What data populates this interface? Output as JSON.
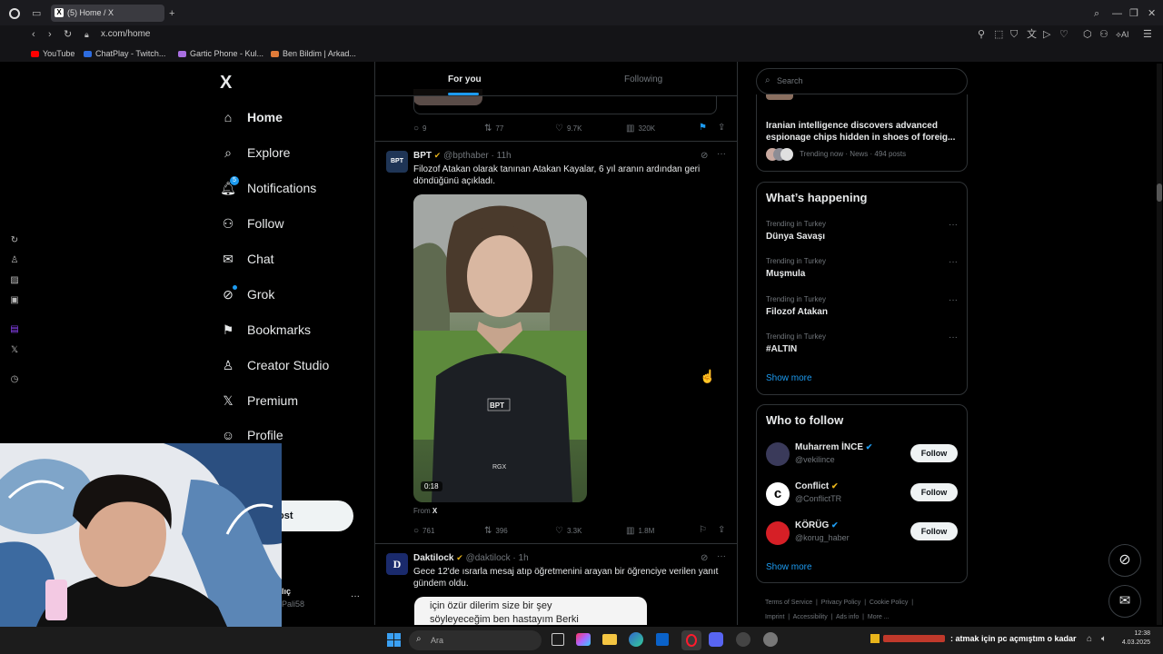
{
  "browser": {
    "tab_title": "(5) Home / X",
    "url": "x.com/home",
    "bookmarks": [
      "YouTube",
      "ChatPlay - Twitch...",
      "Gartic Phone - Kul...",
      "Ben Bildim | Arkad..."
    ],
    "ai_label": "AI"
  },
  "nav": {
    "logo": "X",
    "items": [
      {
        "label": "Home"
      },
      {
        "label": "Explore"
      },
      {
        "label": "Notifications",
        "badge": "5"
      },
      {
        "label": "Follow"
      },
      {
        "label": "Chat"
      },
      {
        "label": "Grok"
      },
      {
        "label": "Bookmarks"
      },
      {
        "label": "Creator Studio"
      },
      {
        "label": "Premium"
      },
      {
        "label": "Profile"
      }
    ],
    "post_button": "ost",
    "account_name": "lıç",
    "account_handle": "Pali58"
  },
  "feed": {
    "tabs": [
      "For you",
      "Following"
    ],
    "top_tweet_stats": {
      "replies": "9",
      "reposts": "77",
      "likes": "9.7K",
      "views": "320K"
    },
    "tweet1": {
      "avatar_text": "BPT",
      "name": "BPT",
      "handle": "@bpthaber",
      "time": "· 11h",
      "text": "Filozof Atakan olarak tanınan Atakan Kayalar, 6 yıl aranın ardından geri döndüğünü açıkladı.",
      "video_duration": "0:18",
      "jacket_logo": "BPT",
      "watermark": "RGX",
      "from_label": "From",
      "from_source": "X",
      "stats": {
        "replies": "761",
        "reposts": "396",
        "likes": "3.3K",
        "views": "1.8M"
      }
    },
    "tweet2": {
      "avatar_text": "D",
      "name": "Daktilock",
      "handle": "@daktilock",
      "time": "· 1h",
      "text": "Gece 12'de ısrarla mesaj atıp öğretmenini arayan bir öğrenciye verilen yanıt gündem oldu.",
      "image_text_line1": "için özür dilerim size bir şey",
      "image_text_line2": "söyleyeceğim ben hastayım Berki"
    }
  },
  "right": {
    "search_placeholder": "Search",
    "top_news": {
      "title": "Iranian intelligence discovers advanced espionage chips hidden in shoes of foreig...",
      "meta": "Trending now · News · 494 posts"
    },
    "whats_happening": {
      "title": "What’s happening",
      "trends": [
        {
          "context": "Trending in Turkey",
          "name": "Dünya Savaşı"
        },
        {
          "context": "Trending in Turkey",
          "name": "Muşmula"
        },
        {
          "context": "Trending in Turkey",
          "name": "Filozof Atakan"
        },
        {
          "context": "Trending in Turkey",
          "name": "#ALTIN"
        }
      ],
      "show_more": "Show more"
    },
    "who_to_follow": {
      "title": "Who to follow",
      "accounts": [
        {
          "name": "Muharrem İNCE",
          "handle": "@vekilince",
          "button": "Follow",
          "badge_color": "#1d9bf0"
        },
        {
          "name": "Conflict",
          "handle": "@ConflictTR",
          "button": "Follow",
          "badge_color": "#e8b41b"
        },
        {
          "name": "KÖRÜG",
          "handle": "@korug_haber",
          "button": "Follow",
          "badge_color": "#1d9bf0"
        }
      ],
      "show_more": "Show more"
    },
    "footer_links": [
      "Terms of Service",
      "Privacy Policy",
      "Cookie Policy",
      "Imprint",
      "Accessibility",
      "Ads info",
      "More ..."
    ]
  },
  "taskbar": {
    "search_placeholder": "Ara",
    "ticker": ": atmak için pc açmıştım o kadar",
    "time": "12:38",
    "date": "4.03.2025"
  },
  "colors": {
    "accent": "#1d9bf0",
    "background": "#000000",
    "border": "#2f3336",
    "muted": "#71767b"
  }
}
